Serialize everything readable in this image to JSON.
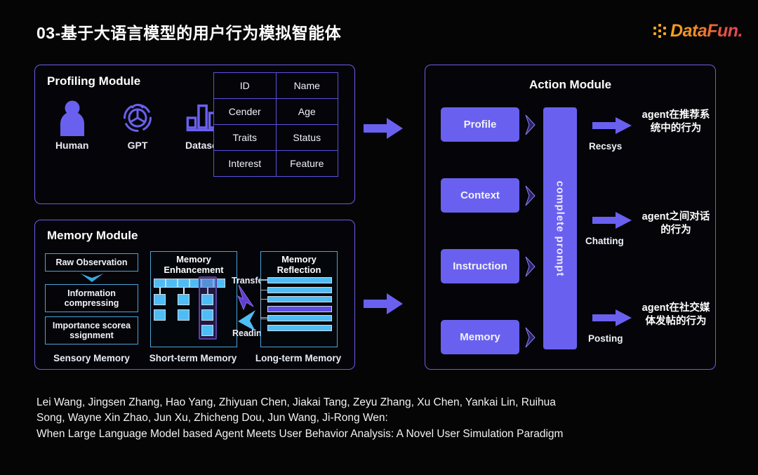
{
  "header": {
    "title": "03-基于大语言模型的用户行为模拟智能体",
    "logo_text": "DataFun.",
    "logo_accent": "#f5a524",
    "logo_accent_end": "#e0445c"
  },
  "profiling": {
    "title": "Profiling Module",
    "icons": [
      {
        "name": "human-icon",
        "label": "Human"
      },
      {
        "name": "gpt-icon",
        "label": "GPT"
      },
      {
        "name": "dataset-icon",
        "label": "Dataset"
      }
    ],
    "table": [
      [
        "ID",
        "Name"
      ],
      [
        "Cender",
        "Age"
      ],
      [
        "Traits",
        "Status"
      ],
      [
        "Interest",
        "Feature"
      ]
    ]
  },
  "memory": {
    "title": "Memory Module",
    "sensory": {
      "caption": "Sensory Memory",
      "boxes": [
        "Raw Observation",
        "Information compressing",
        "Importance scorea ssignment"
      ]
    },
    "short_term": {
      "caption": "Short-term Memory",
      "title_line1": "Memory",
      "title_line2": "Enhancement"
    },
    "long_term": {
      "caption": "Long-term Memory",
      "title_line1": "Memory",
      "title_line2": "Reflection",
      "bar_count": 6,
      "highlight_index": 3
    },
    "transfer_label": "Transfer",
    "reading_label": "Reading"
  },
  "action": {
    "title": "Action Module",
    "inputs": [
      "Profile",
      "Context",
      "Instruction",
      "Memory"
    ],
    "prompt_label": "complete  prompt",
    "outputs": [
      {
        "flow": "Recsys",
        "text": "agent在推荐系统中的行为"
      },
      {
        "flow": "Chatting",
        "text": "agent之间对话的行为"
      },
      {
        "flow": "Posting",
        "text": "agent在社交媒体发帖的行为"
      }
    ]
  },
  "citation": {
    "line1": "Lei Wang, Jingsen Zhang, Hao Yang, Zhiyuan Chen, Jiakai Tang, Zeyu Zhang, Xu Chen, Yankai Lin, Ruihua",
    "line2": "Song, Wayne Xin Zhao, Jun Xu, Zhicheng Dou, Jun Wang, Ji-Rong Wen:",
    "line3": "When Large Language Model based Agent Meets User Behavior Analysis: A Novel User Simulation Paradigm"
  },
  "colors": {
    "accent_purple": "#6a60ef",
    "border_purple": "#6d5ce8",
    "cyan_border": "#4ba3d8",
    "bar_blue": "#4fbdf5",
    "background": "#050505"
  }
}
